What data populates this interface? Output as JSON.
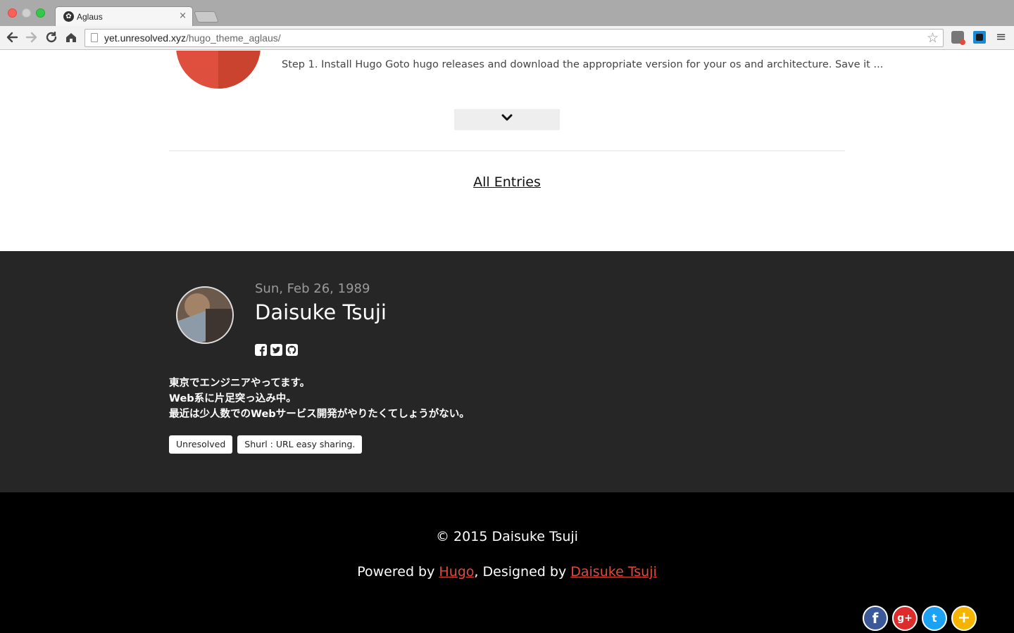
{
  "browser": {
    "tab_title": "Aglaus",
    "tab_close": "×",
    "url_host": "yet.unresolved.xyz",
    "url_path": "/hugo_theme_aglaus/",
    "star": "☆",
    "menu": "≡"
  },
  "post": {
    "excerpt": "Step 1. Install Hugo Goto hugo releases and download the appropriate version for your os and architecture. Save it ..."
  },
  "nav": {
    "all_entries": "All Entries"
  },
  "author": {
    "date": "Sun, Feb 26, 1989",
    "name": "Daisuke Tsuji",
    "bio": [
      "東京でエンジニアやってます。",
      "Web系に片足突っ込み中。",
      "最近は少人数でのWebサービス開発がやりたくてしょうがない。"
    ],
    "links": [
      "Unresolved",
      "Shurl : URL easy sharing."
    ],
    "social_icons": [
      "facebook-icon",
      "twitter-icon",
      "github-icon"
    ]
  },
  "footer": {
    "copyright": "© 2015 Daisuke Tsuji",
    "powered_prefix": "Powered by ",
    "powered_link": "Hugo",
    "designed_prefix": ", Designed by ",
    "designed_link": "Daisuke Tsuji"
  },
  "share": {
    "facebook": "f",
    "googleplus": "g+",
    "twitter": "t",
    "more": "+"
  },
  "colors": {
    "accent": "#e04a3b",
    "author_bg": "#262626",
    "footer_bg": "#000000"
  }
}
